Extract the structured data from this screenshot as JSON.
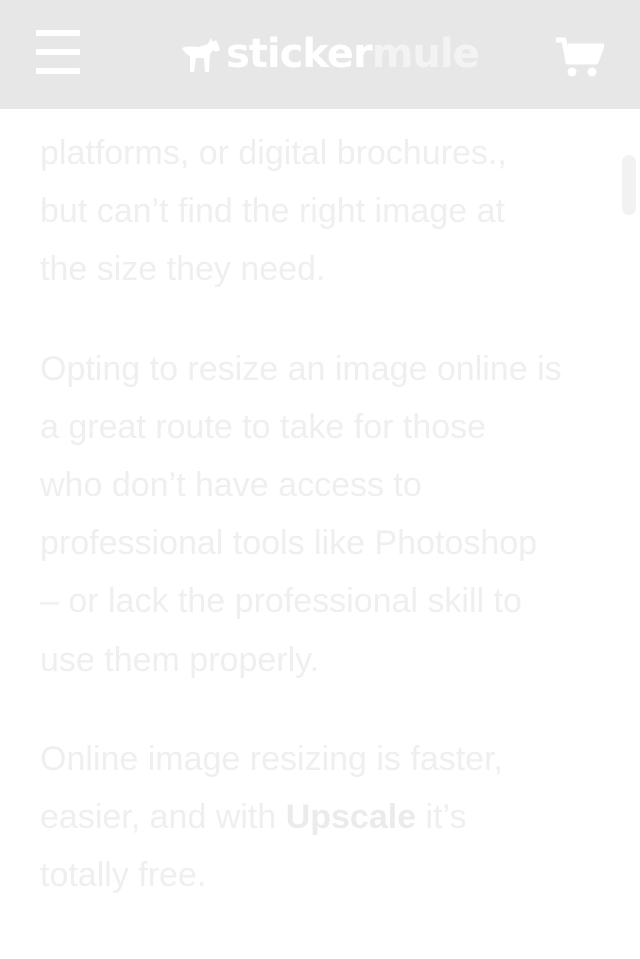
{
  "header": {
    "logo": {
      "part1": "sticker",
      "part2": "mule"
    },
    "menu_icon": "hamburger-menu-icon",
    "cart_icon": "shopping-cart-icon"
  },
  "article": {
    "paragraphs": [
      {
        "lines": [
          "platforms, or digital brochures.,",
          "but can’t find the right image at",
          "the size they need."
        ]
      },
      {
        "lines": [
          "Opting to resize an image online is",
          "a great route to take for those",
          "who don’t have access to",
          "professional tools like Photoshop",
          "– or lack the professional skill to",
          "use them properly."
        ]
      },
      {
        "line1": "Online image resizing is faster,",
        "line2_before": "easier, and with ",
        "line2_bold": "Upscale",
        "line2_after": " it’s",
        "line3": "totally free."
      }
    ]
  },
  "colors": {
    "header_bg": "#e7e7e7",
    "text": "#efefef",
    "icon": "#ffffff"
  }
}
